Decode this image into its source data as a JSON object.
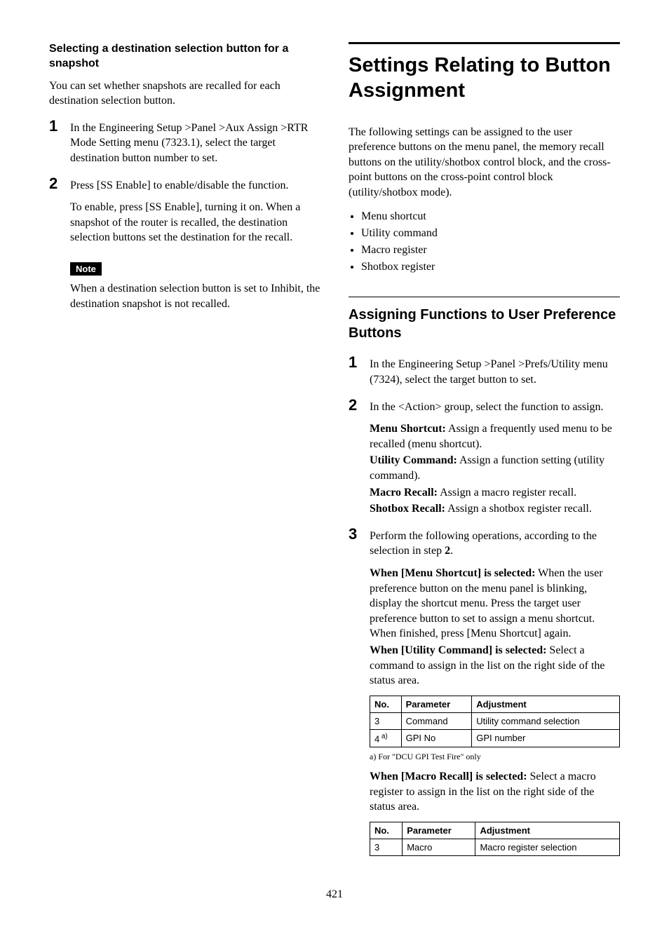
{
  "page_number": "421",
  "left": {
    "h3": "Selecting a destination selection button for a snapshot",
    "intro": "You can set whether snapshots are recalled for each destination selection button.",
    "step1": "In the Engineering Setup >Panel >Aux Assign >RTR Mode Setting menu (7323.1), select the target destination button number to set.",
    "step2": "Press [SS Enable] to enable/disable the function.",
    "step2_detail": "To enable, press [SS Enable], turning it on. When a snapshot of the router is recalled, the destination selection buttons set the destination for the recall.",
    "note_label": "Note",
    "note_body": "When a destination selection button is set to Inhibit, the destination snapshot is not recalled."
  },
  "right": {
    "h1": "Settings Relating to Button Assignment",
    "intro": "The following settings can be assigned to the user preference buttons on the menu panel, the memory recall buttons on the utility/shotbox control block, and the cross-point buttons on the cross-point control block (utility/shotbox mode).",
    "bullets": [
      "Menu shortcut",
      "Utility command",
      "Macro register",
      "Shotbox register"
    ],
    "h2": "Assigning Functions to User Preference Buttons",
    "step1": "In the Engineering Setup >Panel >Prefs/Utility menu (7324), select the target button to set.",
    "step2": "In the <Action> group, select the function to assign.",
    "defs": {
      "menu_shortcut_term": "Menu Shortcut:",
      "menu_shortcut_body": " Assign a frequently used menu to be recalled (menu shortcut).",
      "utility_command_term": "Utility Command:",
      "utility_command_body": " Assign a function setting (utility command).",
      "macro_recall_term": "Macro Recall:",
      "macro_recall_body": " Assign a macro register recall.",
      "shotbox_recall_term": "Shotbox Recall:",
      "shotbox_recall_body": " Assign a shotbox register recall."
    },
    "step3_a": "Perform the following operations, according to the selection in step ",
    "step3_ref": "2",
    "step3_b": ".",
    "when_menu_term": "When [Menu Shortcut] is selected:",
    "when_menu_body": " When the user preference button on the menu panel is blinking, display the shortcut menu. Press the target user preference button to set to assign a menu shortcut. When finished, press [Menu Shortcut] again.",
    "when_util_term": "When [Utility Command] is selected:",
    "when_util_body": " Select a command to assign in the list on the right side of the status area.",
    "table1": {
      "headers": [
        "No.",
        "Parameter",
        "Adjustment"
      ],
      "rows": [
        {
          "no": "3",
          "param": "Command",
          "adj": "Utility command selection"
        },
        {
          "no_pre": "4",
          "no_sup": " a)",
          "param": "GPI No",
          "adj": "GPI number"
        }
      ]
    },
    "footnote1": "a) For \"DCU GPI Test Fire\" only",
    "when_macro_term": "When [Macro Recall] is selected:",
    "when_macro_body": " Select a macro register to assign in the list on the right side of the status area.",
    "table2": {
      "headers": [
        "No.",
        "Parameter",
        "Adjustment"
      ],
      "rows": [
        {
          "no": "3",
          "param": "Macro",
          "adj": "Macro register selection"
        }
      ]
    }
  }
}
